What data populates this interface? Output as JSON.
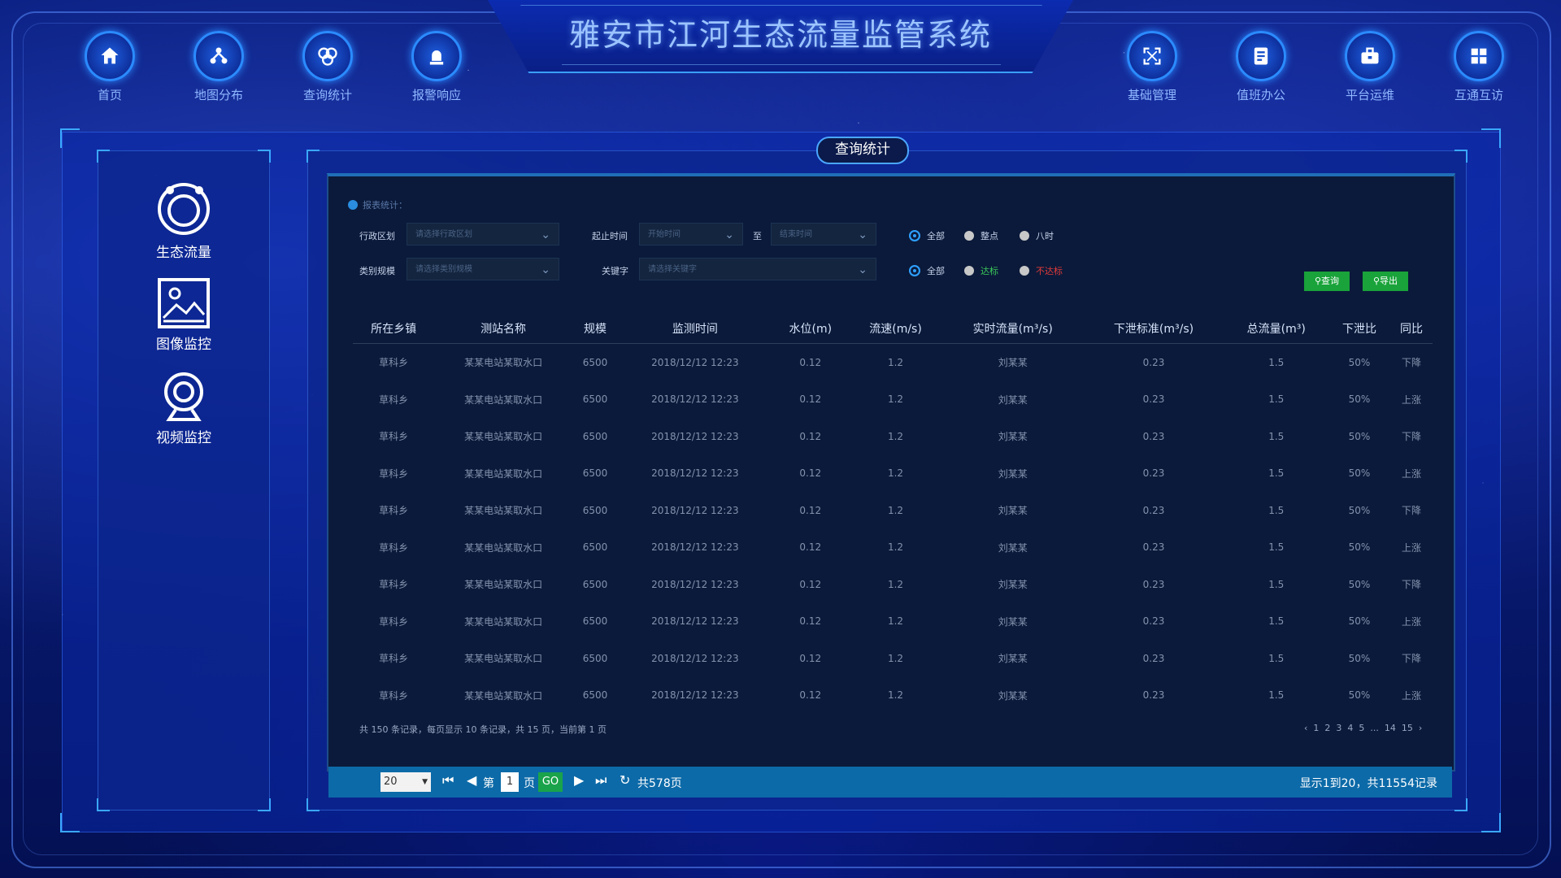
{
  "header": {
    "title": "雅安市江河生态流量监管系统",
    "nav_left": [
      {
        "label": "首页",
        "icon": "home-icon"
      },
      {
        "label": "地图分布",
        "icon": "map-icon"
      },
      {
        "label": "查询统计",
        "icon": "stats-icon"
      },
      {
        "label": "报警响应",
        "icon": "alarm-icon"
      }
    ],
    "nav_right": [
      {
        "label": "基础管理",
        "icon": "expand-icon"
      },
      {
        "label": "值班办公",
        "icon": "document-icon"
      },
      {
        "label": "平台运维",
        "icon": "briefcase-icon"
      },
      {
        "label": "互通互访",
        "icon": "grid-icon"
      }
    ]
  },
  "section_title": "查询统计",
  "sidebar": {
    "items": [
      {
        "label": "生态流量",
        "icon": "ecology-icon"
      },
      {
        "label": "图像监控",
        "icon": "image-icon"
      },
      {
        "label": "视频监控",
        "icon": "camera-icon"
      }
    ]
  },
  "filters": {
    "title": "报表统计：",
    "region_label": "行政区划",
    "region_placeholder": "请选择行政区划",
    "start_label": "起止时间",
    "start_placeholder": "开始时间",
    "to_label": "至",
    "end_placeholder": "结束时间",
    "time_radios": [
      "全部",
      "整点",
      "八时"
    ],
    "scale_label": "类别规模",
    "scale_placeholder": "请选择类别规模",
    "keyword_label": "关键字",
    "keyword_placeholder": "请选择关键字",
    "status_radios": [
      "全部",
      "达标",
      "不达标"
    ],
    "query_button": "查询",
    "export_button": "导出"
  },
  "table": {
    "headers": [
      "所在乡镇",
      "测站名称",
      "规模",
      "监测时间",
      "水位(m)",
      "流速(m/s)",
      "实时流量(m³/s)",
      "下泄标准(m³/s)",
      "总流量(m³)",
      "下泄比",
      "同比"
    ],
    "rows": [
      [
        "草科乡",
        "某某电站某取水口",
        "6500",
        "2018/12/12 12:23",
        "0.12",
        "1.2",
        "刘某某",
        "0.23",
        "1.5",
        "50%",
        "下降"
      ],
      [
        "草科乡",
        "某某电站某取水口",
        "6500",
        "2018/12/12 12:23",
        "0.12",
        "1.2",
        "刘某某",
        "0.23",
        "1.5",
        "50%",
        "上涨"
      ],
      [
        "草科乡",
        "某某电站某取水口",
        "6500",
        "2018/12/12 12:23",
        "0.12",
        "1.2",
        "刘某某",
        "0.23",
        "1.5",
        "50%",
        "下降"
      ],
      [
        "草科乡",
        "某某电站某取水口",
        "6500",
        "2018/12/12 12:23",
        "0.12",
        "1.2",
        "刘某某",
        "0.23",
        "1.5",
        "50%",
        "上涨"
      ],
      [
        "草科乡",
        "某某电站某取水口",
        "6500",
        "2018/12/12 12:23",
        "0.12",
        "1.2",
        "刘某某",
        "0.23",
        "1.5",
        "50%",
        "下降"
      ],
      [
        "草科乡",
        "某某电站某取水口",
        "6500",
        "2018/12/12 12:23",
        "0.12",
        "1.2",
        "刘某某",
        "0.23",
        "1.5",
        "50%",
        "上涨"
      ],
      [
        "草科乡",
        "某某电站某取水口",
        "6500",
        "2018/12/12 12:23",
        "0.12",
        "1.2",
        "刘某某",
        "0.23",
        "1.5",
        "50%",
        "下降"
      ],
      [
        "草科乡",
        "某某电站某取水口",
        "6500",
        "2018/12/12 12:23",
        "0.12",
        "1.2",
        "刘某某",
        "0.23",
        "1.5",
        "50%",
        "上涨"
      ],
      [
        "草科乡",
        "某某电站某取水口",
        "6500",
        "2018/12/12 12:23",
        "0.12",
        "1.2",
        "刘某某",
        "0.23",
        "1.5",
        "50%",
        "下降"
      ],
      [
        "草科乡",
        "某某电站某取水口",
        "6500",
        "2018/12/12 12:23",
        "0.12",
        "1.2",
        "刘某某",
        "0.23",
        "1.5",
        "50%",
        "上涨"
      ]
    ]
  },
  "pager": {
    "summary": "共 150 条记录，每页显示 10 条记录，共 15 页，当前第 1 页",
    "pages": [
      "‹",
      "1",
      "2",
      "3",
      "4",
      "5",
      "...",
      "14",
      "15",
      "›"
    ]
  },
  "bottom_bar": {
    "page_size": "20",
    "page_prefix": "第",
    "current_page": "1",
    "page_suffix": "页",
    "go_label": "GO",
    "total_pages": "共578页",
    "info": "显示1到20，共11554记录"
  },
  "colors": {
    "accent": "#2b8bff",
    "green_button": "#19a33a",
    "bottom_bar": "#0c6aa8"
  }
}
